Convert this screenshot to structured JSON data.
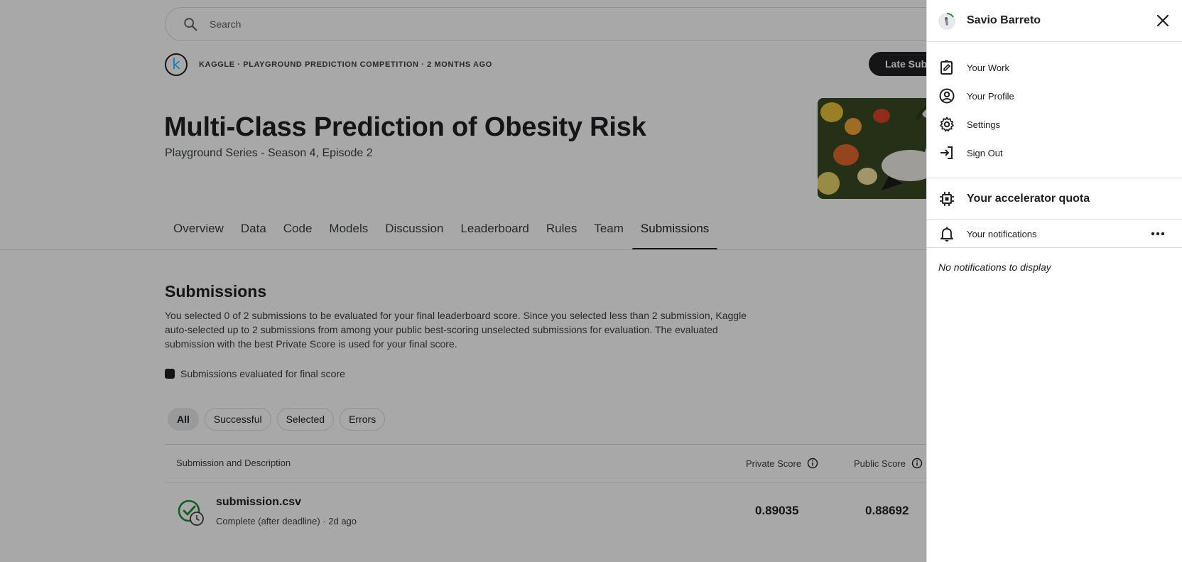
{
  "search": {
    "placeholder": "Search"
  },
  "competition": {
    "logo_letter": "k",
    "meta": "KAGGLE · PLAYGROUND PREDICTION COMPETITION · 2 MONTHS AGO",
    "late_submission_label": "Late Submission",
    "title": "Multi-Class Prediction of Obesity Risk",
    "subtitle": "Playground Series - Season 4, Episode 2"
  },
  "tabs": [
    {
      "label": "Overview"
    },
    {
      "label": "Data"
    },
    {
      "label": "Code"
    },
    {
      "label": "Models"
    },
    {
      "label": "Discussion"
    },
    {
      "label": "Leaderboard"
    },
    {
      "label": "Rules"
    },
    {
      "label": "Team"
    },
    {
      "label": "Submissions",
      "active": true
    }
  ],
  "submissions": {
    "heading": "Submissions",
    "description": "You selected 0 of 2 submissions to be evaluated for your final leaderboard score. Since you selected less than 2 submission, Kaggle auto-selected up to 2 submissions from among your public best-scoring unselected submissions for evaluation. The evaluated submission with the best Private Score is used for your final score.",
    "legend": "Submissions evaluated for final score",
    "filters": [
      {
        "label": "All",
        "active": true
      },
      {
        "label": "Successful"
      },
      {
        "label": "Selected"
      },
      {
        "label": "Errors"
      }
    ],
    "columns": {
      "description": "Submission and Description",
      "private": "Private Score",
      "public": "Public Score"
    },
    "rows": [
      {
        "file": "submission.csv",
        "status": "Complete (after deadline) · 2d ago",
        "private_score": "0.89035",
        "public_score": "0.88692"
      }
    ]
  },
  "panel": {
    "username": "Savio Barreto",
    "menu": [
      {
        "label": "Your Work",
        "icon": "edit-note-icon"
      },
      {
        "label": "Your Profile",
        "icon": "account-circle-icon"
      },
      {
        "label": "Settings",
        "icon": "gear-icon"
      },
      {
        "label": "Sign Out",
        "icon": "sign-out-icon"
      }
    ],
    "quota_label": "Your accelerator quota",
    "notifications_label": "Your notifications",
    "empty_text": "No notifications to display"
  },
  "colors": {
    "primary": "#202124",
    "success": "#1e8e3e",
    "kaggle_blue": "#20beff",
    "overlay": "rgba(0,0,0,0.34)"
  }
}
